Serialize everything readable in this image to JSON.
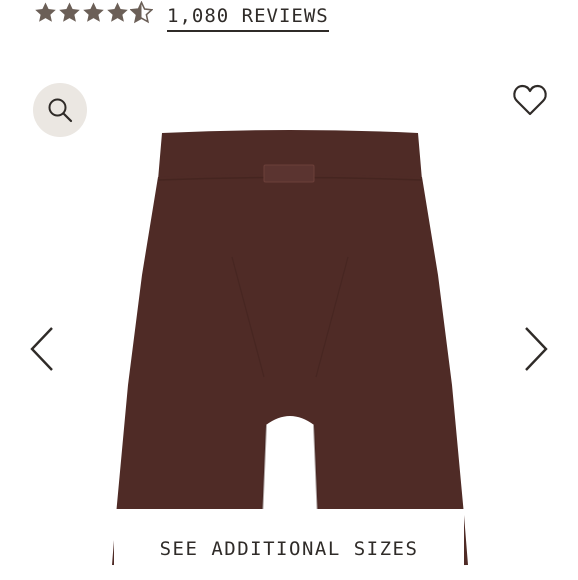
{
  "rating": {
    "stars_value": 4.5,
    "stars_max": 5,
    "reviews_label": "1,080 REVIEWS"
  },
  "gallery": {
    "zoom_icon": "search-icon",
    "wishlist_icon": "heart-icon",
    "prev_icon": "chevron-left-icon",
    "next_icon": "chevron-right-icon",
    "product_color": "#4f2b26",
    "sizes_banner_label": "SEE ADDITIONAL SIZES"
  },
  "colors": {
    "text": "#2f2b28",
    "star": "#6b5f57",
    "zoom_bg": "#ebe7e2"
  }
}
